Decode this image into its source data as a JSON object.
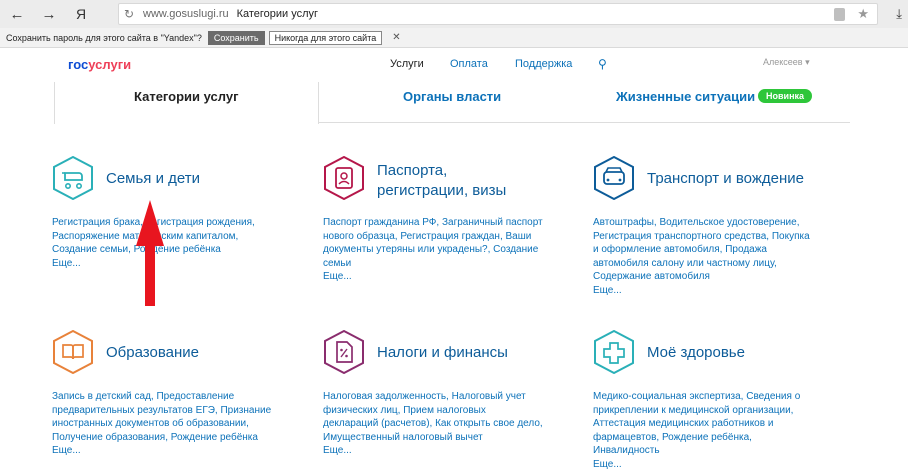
{
  "browser": {
    "back_icon": "arrow-left",
    "forward_icon": "arrow-right",
    "yandex_logo": "Я",
    "domain": "www.gosuslugi.ru",
    "page_title": "Категории услуг"
  },
  "password_bar": {
    "text": "Сохранить пароль для этого сайта в \"Yandex\"?",
    "save_label": "Сохранить",
    "never_label": "Никогда для этого сайта",
    "close_label": "✕"
  },
  "header": {
    "logo_gos": "гос",
    "logo_uslugi": "услуги",
    "nav": {
      "services": "Услуги",
      "payment": "Оплата",
      "support": "Поддержка"
    },
    "user_name": "Алексеев"
  },
  "tabs": {
    "categories": "Категории услуг",
    "authorities": "Органы власти",
    "life": "Жизненные ситуации",
    "new_badge": "Новинка"
  },
  "categories": [
    {
      "name": "Семья и дети",
      "icon": "baby-carriage-icon",
      "links": [
        "Регистрация брака, регистрация рождения,",
        "Распоряжение материнским капиталом,",
        "Создание семьи, Рождение ребёнка",
        "Еще..."
      ]
    },
    {
      "name_line1": "Паспорта,",
      "name_line2": "регистрации, визы",
      "icon": "passport-icon",
      "links": [
        "Паспорт гражданина РФ, Заграничный паспорт",
        "нового образца, Регистрация граждан, Ваши",
        "документы утеряны или украдены?, Создание",
        "семьи",
        "Еще..."
      ]
    },
    {
      "name": "Транспорт и вождение",
      "icon": "car-icon",
      "links": [
        "Автоштрафы, Водительское удостоверение,",
        "Регистрация транспортного средства, Покупка",
        "и оформление автомобиля, Продажа",
        "автомобиля салону или частному лицу,",
        "Содержание автомобиля",
        "Еще..."
      ]
    },
    {
      "name": "Образование",
      "icon": "book-icon",
      "links": [
        "Запись в детский сад, Предоставление",
        "предварительных результатов ЕГЭ, Признание",
        "иностранных документов об образовании,",
        "Получение образования, Рождение ребёнка",
        "Еще..."
      ]
    },
    {
      "name": "Налоги и финансы",
      "icon": "tax-document-icon",
      "links": [
        "Налоговая задолженность, Налоговый учет",
        "физических лиц, Прием налоговых",
        "деклараций (расчетов), Как открыть свое дело,",
        "Имущественный налоговый вычет",
        "Еще..."
      ]
    },
    {
      "name": "Моё здоровье",
      "icon": "medical-cross-icon",
      "links": [
        "Медико-социальная экспертиза, Сведения о",
        "прикреплении к медицинской организации,",
        "Аттестация медицинских работников и",
        "фармацевтов, Рождение ребёнка,",
        "Инвалидность",
        "Еще..."
      ]
    }
  ],
  "colors": {
    "family": "#2ab0b8",
    "passport": "#b5174a",
    "transport": "#0d5c99",
    "education": "#e8823a",
    "taxes": "#8a2d6e",
    "health": "#2ab0b8",
    "arrow": "#e8151f"
  }
}
